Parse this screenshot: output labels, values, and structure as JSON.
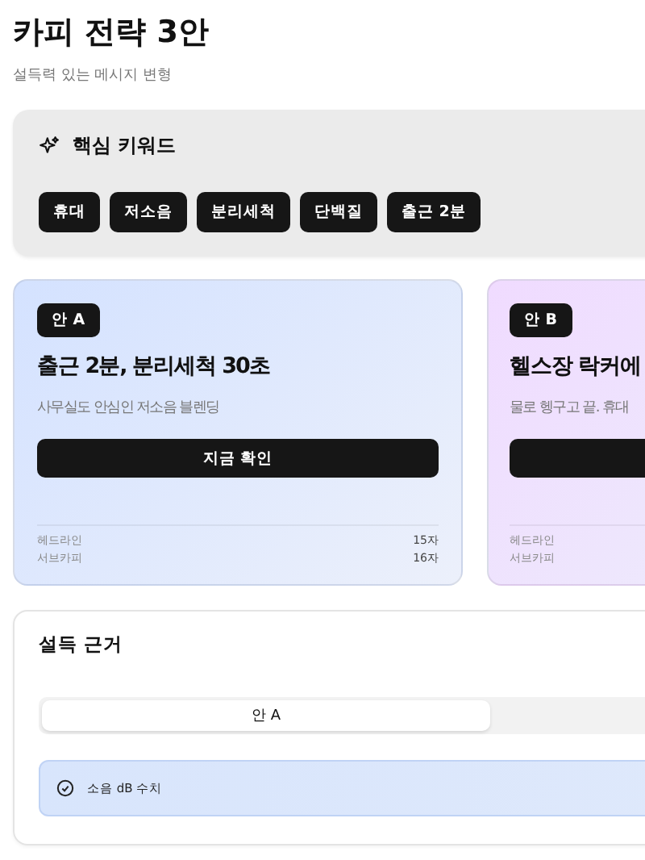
{
  "header": {
    "title": "카피 전략 3안",
    "subtitle": "설득력 있는 메시지 변형"
  },
  "keywords": {
    "title": "핵심 키워드",
    "tags": [
      "휴대",
      "저소음",
      "분리세척",
      "단백질",
      "출근 2분"
    ]
  },
  "variants": [
    {
      "badge": "안 A",
      "headline": "출근 2분, 분리세척 30초",
      "subcopy": "사무실도 안심인 저소음 블렌딩",
      "cta": "지금 확인",
      "color": "#d4e2ff",
      "stats": [
        {
          "label": "헤드라인",
          "value": "15자"
        },
        {
          "label": "서브카피",
          "value": "16자"
        }
      ]
    },
    {
      "badge": "안 B",
      "headline": "헬스장 락커에",
      "subcopy": "물로 헹구고 끝. 휴대",
      "color": "#f0dbff",
      "stats": [
        {
          "label": "헤드라인"
        },
        {
          "label": "서브카피"
        }
      ]
    }
  ],
  "evidence": {
    "title": "설득 근거",
    "tabs": [
      {
        "label": "안 A",
        "selected": true
      }
    ],
    "items": [
      "소음 dB 수치"
    ]
  }
}
